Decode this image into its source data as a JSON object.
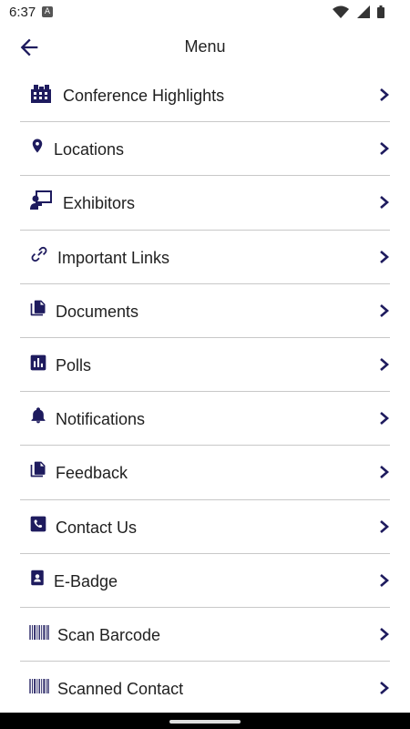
{
  "status_bar": {
    "time": "6:37",
    "notif_letter": "A"
  },
  "header": {
    "title": "Menu"
  },
  "menu": {
    "items": [
      {
        "label": "Conference Highlights",
        "icon": "conference-icon"
      },
      {
        "label": "Locations",
        "icon": "location-pin-icon"
      },
      {
        "label": "Exhibitors",
        "icon": "presenter-icon"
      },
      {
        "label": "Important Links",
        "icon": "link-icon"
      },
      {
        "label": "Documents",
        "icon": "documents-icon"
      },
      {
        "label": "Polls",
        "icon": "poll-icon"
      },
      {
        "label": "Notifications",
        "icon": "bell-icon"
      },
      {
        "label": "Feedback",
        "icon": "feedback-icon"
      },
      {
        "label": "Contact Us",
        "icon": "phone-icon"
      },
      {
        "label": "E-Badge",
        "icon": "badge-icon"
      },
      {
        "label": "Scan Barcode",
        "icon": "barcode-icon"
      },
      {
        "label": "Scanned Contact",
        "icon": "barcode-icon"
      }
    ]
  },
  "colors": {
    "icon": "#1e1b5e",
    "divider": "#c8c8c8",
    "text": "#1f1f1f"
  }
}
